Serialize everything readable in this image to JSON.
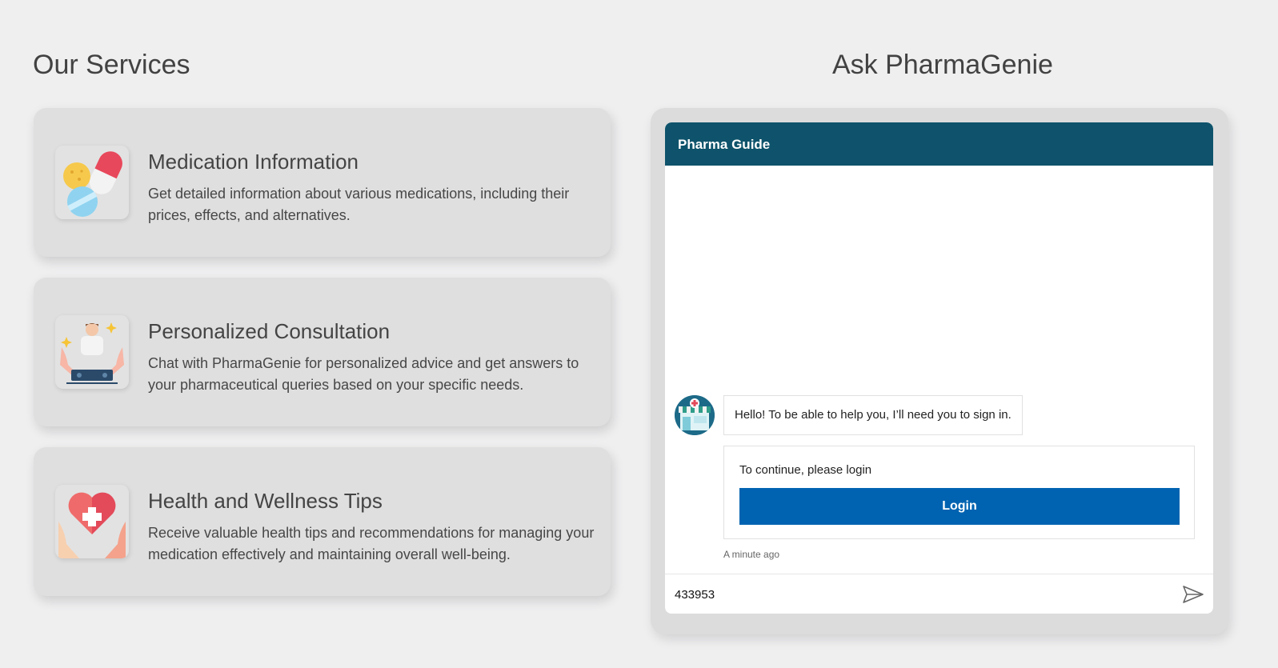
{
  "services": {
    "title": "Our Services",
    "cards": [
      {
        "title": "Medication Information",
        "description": "Get detailed information about various medications, including their prices, effects, and alternatives.",
        "icon": "pills-icon"
      },
      {
        "title": "Personalized Consultation",
        "description": "Chat with PharmaGenie for personalized advice and get answers to your pharmaceutical queries based on your specific needs.",
        "icon": "doctor-consultation-icon"
      },
      {
        "title": "Health and Wellness Tips",
        "description": "Receive valuable health tips and recommendations for managing your medication effectively and maintaining overall well-being.",
        "icon": "heart-hands-icon"
      }
    ]
  },
  "chat": {
    "section_title": "Ask PharmaGenie",
    "header_title": "Pharma Guide",
    "bot_message": "Hello! To be able to help you, I’ll need you to sign in.",
    "login_prompt": "To continue, please login",
    "login_button": "Login",
    "timestamp": "A minute ago",
    "input_value": "433953",
    "send_icon": "send-icon"
  },
  "colors": {
    "chat_header": "#0e536b",
    "login_button": "#0063b1",
    "page_background": "#efeff0",
    "card_background": "#dfdfdf"
  }
}
